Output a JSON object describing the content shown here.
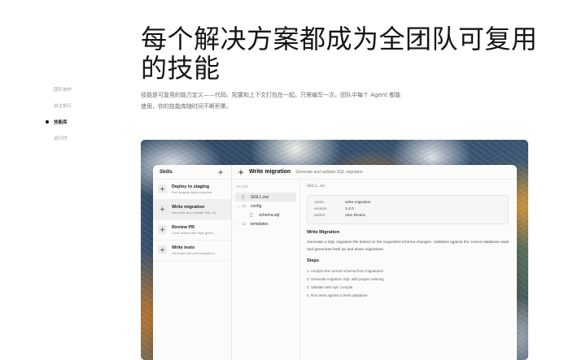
{
  "hero": {
    "title": "每个解决方案都成为全团队可复用的技能",
    "description": "技能是可复用的能力定义——代码、配置和上下文打包在一起。只需编写一次，团队中每个 Agent 都能使用，你的技能库随时间不断积累。"
  },
  "side_nav": {
    "items": [
      {
        "label": "团队协作",
        "active": false
      },
      {
        "label": "自主执行",
        "active": false
      },
      {
        "label": "技能库",
        "active": true
      },
      {
        "label": "运行时",
        "active": false
      }
    ]
  },
  "app": {
    "skills_panel": {
      "title": "Skills",
      "items": [
        {
          "name": "Deploy to staging",
          "desc": "Run staging deploy pipeline",
          "active": false
        },
        {
          "name": "Write migration",
          "desc": "Generate and validate SQL mi...",
          "active": true
        },
        {
          "name": "Review PR",
          "desc": "Code review with style guide ...",
          "active": false
        },
        {
          "name": "Write tests",
          "desc": "Generate unit and integration...",
          "active": false
        }
      ]
    },
    "detail": {
      "title": "Write migration",
      "subtitle": "Generate and validate SQL migration",
      "files_label": "FILES",
      "files": [
        {
          "name": "SKILL.md",
          "type": "file",
          "indent": 0,
          "expanded": null,
          "active": true
        },
        {
          "name": "config",
          "type": "folder",
          "indent": 0,
          "expanded": true,
          "active": false
        },
        {
          "name": "schema.sql",
          "type": "file",
          "indent": 1,
          "expanded": null,
          "active": false
        },
        {
          "name": "templates",
          "type": "folder",
          "indent": 0,
          "expanded": false,
          "active": false
        }
      ],
      "path": "SKILL.md",
      "meta": [
        {
          "key": "name",
          "value": "write-migration"
        },
        {
          "key": "version",
          "value": "1.2.0"
        },
        {
          "key": "author",
          "value": "Alex Rivera"
        }
      ],
      "heading": "Write Migration",
      "paragraph": "Generate a SQL migration file based on the requested schema changes. Validates against the current database state and generates both up and down migrations.",
      "steps_heading": "Steps",
      "steps": [
        "1. Analyze the current schema from migrations/",
        "2. Generate migration SQL with proper ordering",
        "3. Validate with sqlc compile",
        "4. Run tests against a fresh database"
      ]
    }
  }
}
